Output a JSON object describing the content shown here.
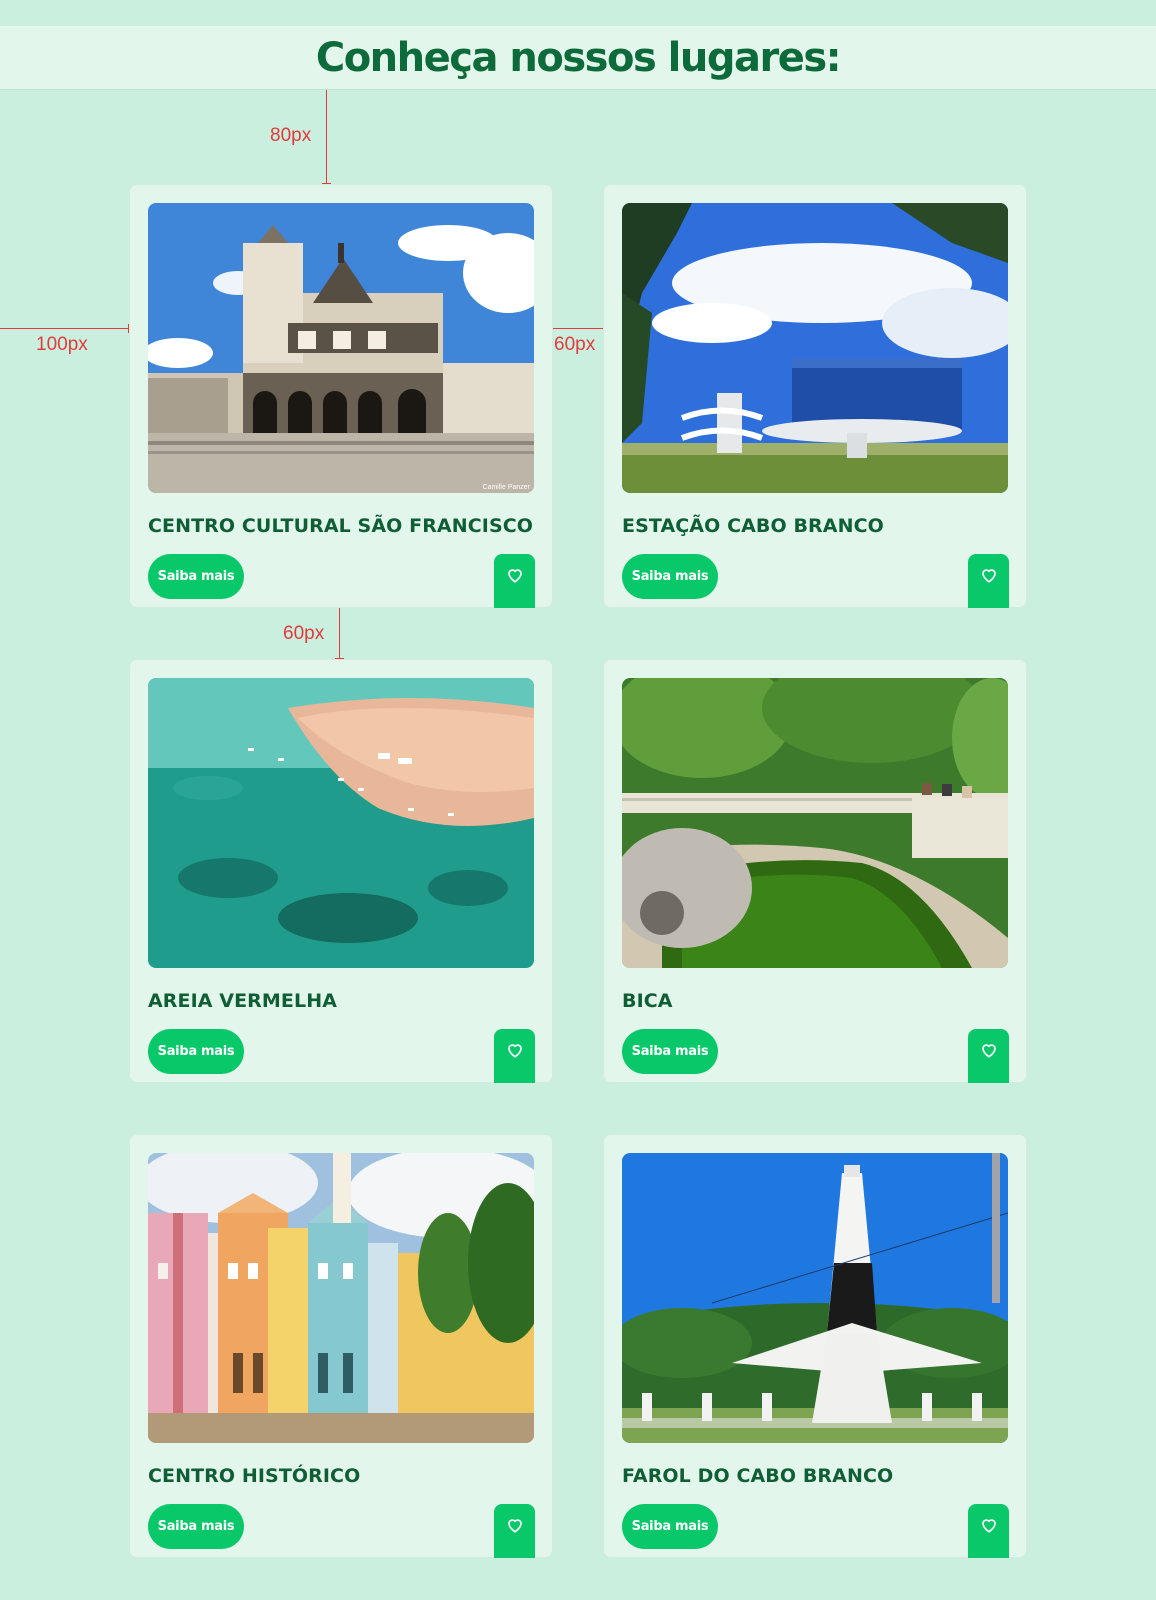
{
  "header": {
    "title": "Conheça nossos lugares:"
  },
  "annotations": {
    "top_gap": "80px",
    "left_margin": "100px",
    "column_gap": "60px",
    "row_gap": "60px"
  },
  "places": [
    {
      "title": "CENTRO CULTURAL SÃO FRANCISCO",
      "button": "Saiba mais",
      "image": "baroque-church-photo",
      "credit": "Camille Panzer"
    },
    {
      "title": "ESTAÇÃO CABO BRANCO",
      "button": "Saiba mais",
      "image": "modern-glass-building-photo"
    },
    {
      "title": "AREIA VERMELHA",
      "button": "Saiba mais",
      "image": "aerial-beach-sandbank-photo"
    },
    {
      "title": "BICA",
      "button": "Saiba mais",
      "image": "park-pond-photo"
    },
    {
      "title": "CENTRO HISTÓRICO",
      "button": "Saiba mais",
      "image": "colorful-colonial-houses-photo"
    },
    {
      "title": "FAROL DO CABO BRANCO",
      "button": "Saiba mais",
      "image": "lighthouse-photo"
    }
  ],
  "colors": {
    "page_background": "#cbefdf",
    "card_background": "#e3f6ec",
    "accent": "#09c86a",
    "title_text": "#0f5e35",
    "annotation": "#e23b3b"
  }
}
